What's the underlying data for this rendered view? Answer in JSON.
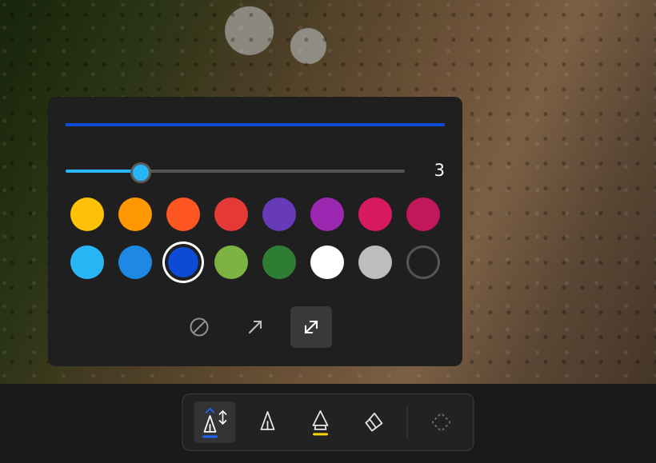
{
  "panel": {
    "preview": {
      "thickness": 4,
      "color": "#0b4bd6"
    },
    "slider": {
      "min": 1,
      "max": 10,
      "value": 3,
      "fill_color": "#29b6f6"
    },
    "colors": {
      "row1": [
        "#ffc107",
        "#ff9800",
        "#ff5722",
        "#e53935",
        "#673ab7",
        "#9c27b0",
        "#d81b60",
        "#c2185b"
      ],
      "row2": [
        "#29b6f6",
        "#1e88e5",
        "#0b4bd6",
        "#7cb342",
        "#2e7d32",
        "#ffffff",
        "#bdbdbd",
        "#555555"
      ],
      "row2_hollow_index": 7,
      "selected_index": 10
    },
    "tips": {
      "items": [
        "no-tip",
        "single-arrow",
        "double-arrow"
      ],
      "selected_index": 2
    }
  },
  "toolbar": {
    "tools": [
      {
        "id": "pen-primary",
        "underline": "#1e66ff",
        "selected": true,
        "chevron": "up",
        "adjust": true
      },
      {
        "id": "pen-secondary",
        "underline": null,
        "selected": false
      },
      {
        "id": "highlighter",
        "underline": "#ffd600",
        "selected": false
      },
      {
        "id": "eraser",
        "underline": null,
        "selected": false
      },
      {
        "id": "shape-crop",
        "underline": null,
        "selected": false,
        "dim": true
      }
    ]
  }
}
